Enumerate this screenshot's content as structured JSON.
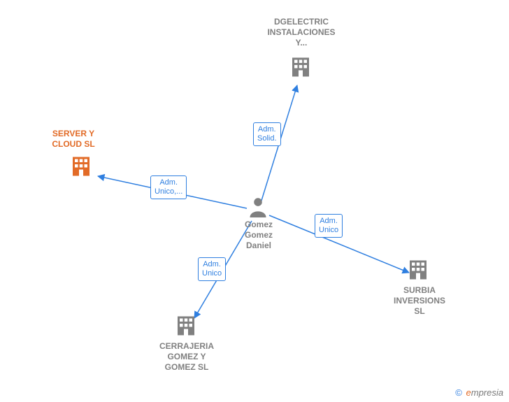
{
  "center": {
    "name": "Gomez\nGomez\nDaniel"
  },
  "nodes": {
    "top": {
      "label": "DGELECTRIC\nINSTALACIONES\nY...",
      "highlight": false
    },
    "left": {
      "label": "SERVER Y\nCLOUD  SL",
      "highlight": true
    },
    "bottom": {
      "label": "CERRAJERIA\nGOMEZ Y\nGOMEZ SL",
      "highlight": false
    },
    "right": {
      "label": "SURBIA\nINVERSIONS\nSL",
      "highlight": false
    }
  },
  "edges": {
    "top": {
      "label": "Adm.\nSolid."
    },
    "left": {
      "label": "Adm.\nUnico,..."
    },
    "bottom": {
      "label": "Adm.\nUnico"
    },
    "right": {
      "label": "Adm.\nUnico"
    }
  },
  "footer": {
    "copyright_symbol": "©",
    "brand_first": "e",
    "brand_rest": "mpresia"
  },
  "colors": {
    "edge": "#2f7fe0",
    "node_gray": "#808080",
    "node_orange": "#e26b27"
  }
}
